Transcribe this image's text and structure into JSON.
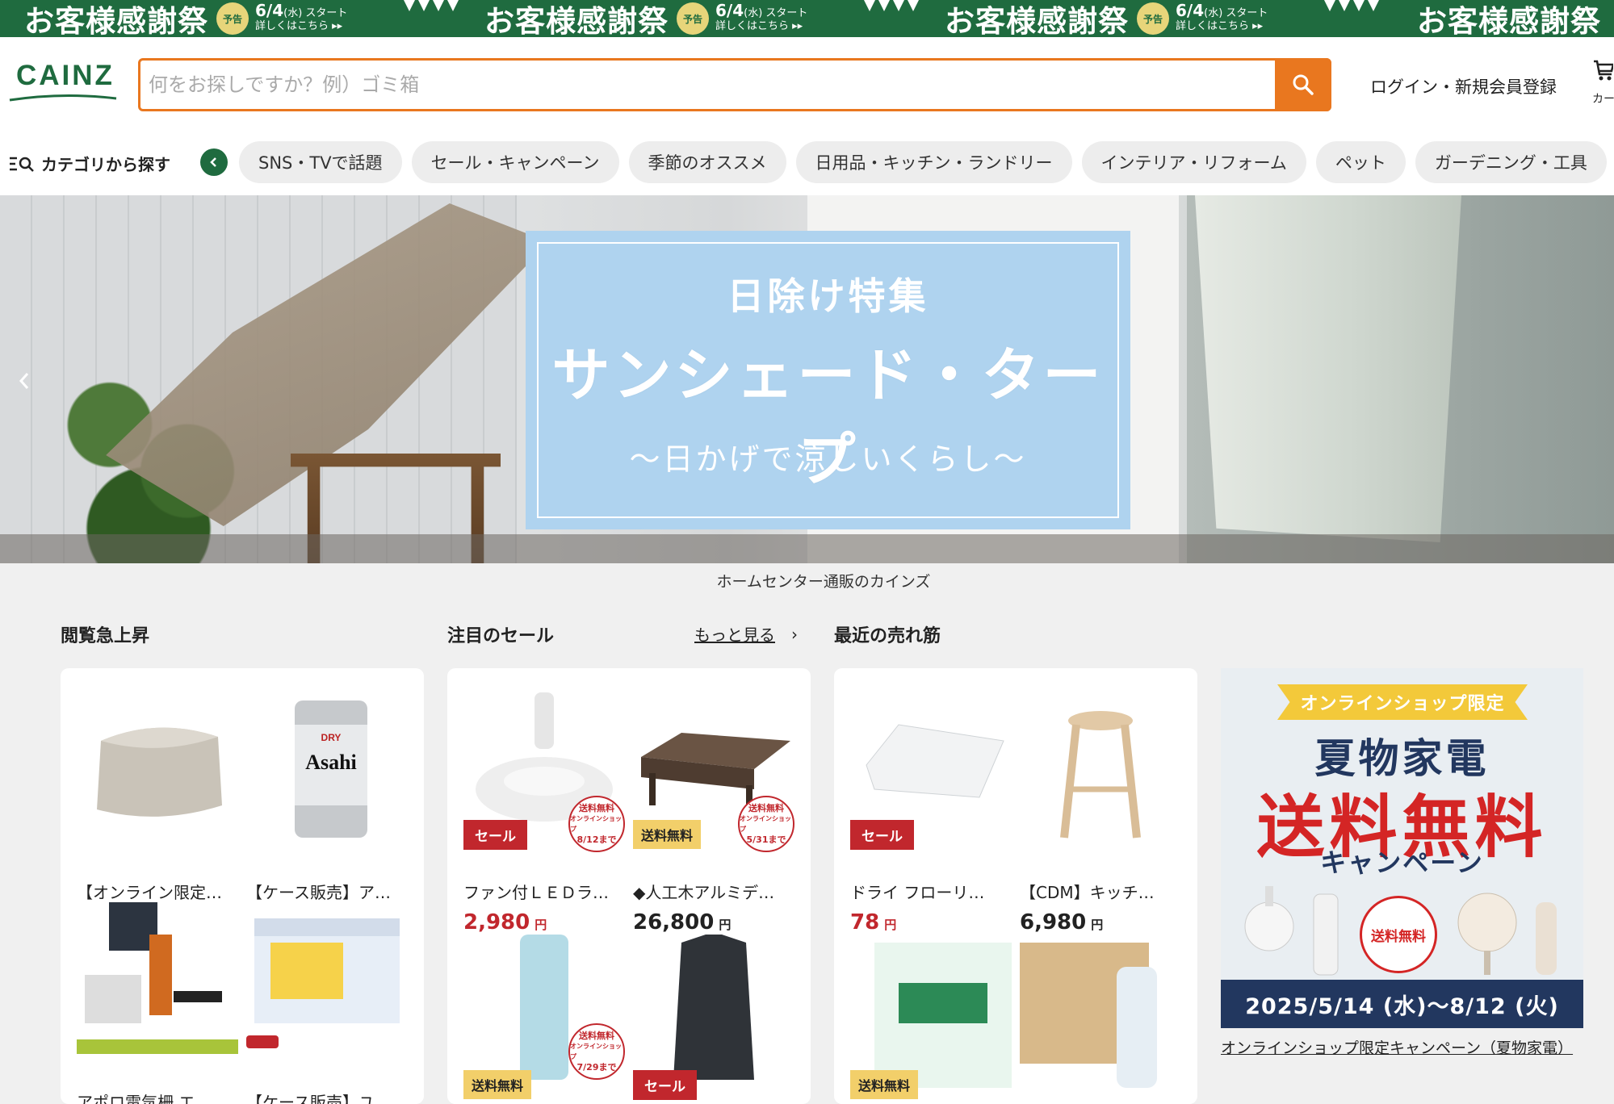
{
  "top_banner": {
    "title": "お客様感謝祭",
    "badge": "予告",
    "date": "6/4",
    "date_suffix": "(水) スタート",
    "detail": "詳しくはこちら ▸▸"
  },
  "header": {
    "logo": "CAINZ",
    "search_placeholder": "何をお探しですか？例）ゴミ箱",
    "search_value": "",
    "login_label": "ログイン・新規会員登録",
    "cart_label": "カー"
  },
  "category_bar": {
    "search_label": "カテゴリから探す",
    "items": [
      {
        "label": "SNS・TVで話題"
      },
      {
        "label": "セール・キャンペーン"
      },
      {
        "label": "季節のオススメ"
      },
      {
        "label": "日用品・キッチン・ランドリー"
      },
      {
        "label": "インテリア・リフォーム"
      },
      {
        "label": "ペット"
      },
      {
        "label": "ガーデニング・工具"
      }
    ]
  },
  "hero": {
    "subtitle": "日除け特集",
    "title": "サンシェード・タープ",
    "tagline": "〜日かげで涼しいくらし〜"
  },
  "site_tagline": "ホームセンター通販のカインズ",
  "sections": {
    "trending": {
      "title": "閲覧急上昇",
      "products": [
        {
          "name": "【オンライン限定…"
        },
        {
          "name": "【ケース販売】ア…"
        },
        {
          "name": "アポロ電気柵 エ…"
        },
        {
          "name": "【ケース販売】ユ…"
        }
      ]
    },
    "sale": {
      "title": "注目のセール",
      "more_label": "もっと見る",
      "products": [
        {
          "name": "ファン付ＬＥＤラ…",
          "price": "2,980",
          "unit": "円",
          "tag": "セール",
          "stamp_note": "8/12まで"
        },
        {
          "name": "◆人工木アルミデ…",
          "price": "26,800",
          "unit": "円",
          "tag": "送料無料",
          "stamp_note": "5/31まで"
        },
        {
          "name": "",
          "tag": "送料無料",
          "stamp_note": "7/29まで"
        },
        {
          "name": "",
          "tag": "セール"
        }
      ]
    },
    "recent": {
      "title": "最近の売れ筋",
      "products": [
        {
          "name": "ドライ フローリ…",
          "price": "78",
          "unit": "円",
          "tag": "セール"
        },
        {
          "name": "【CDM】キッチ…",
          "price": "6,980",
          "unit": "円"
        },
        {
          "name": "",
          "tag": "送料無料"
        },
        {
          "name": ""
        }
      ]
    }
  },
  "stamp_text": {
    "line1": "送料無料",
    "line2": "オンラインショップ"
  },
  "promo": {
    "ribbon": "オンラインショップ限定",
    "title1": "夏物家電",
    "title2": "送料無料",
    "title3": "キャンペーン",
    "stamp": "送料無料",
    "period": "2025/5/14 (水)〜8/12 (火)",
    "link": "オンラインショップ限定キャンペーン（夏物家電）"
  },
  "colors": {
    "brand_green": "#1f6b3f",
    "search_orange": "#e9771f",
    "sale_red": "#c1272d",
    "free_ship_yellow": "#f2cf6a"
  }
}
